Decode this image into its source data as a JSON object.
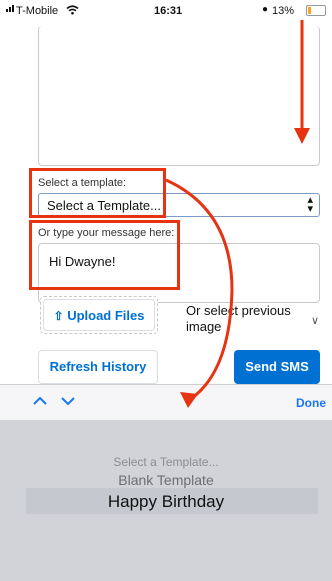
{
  "status_bar": {
    "carrier": "T-Mobile",
    "time": "16:31",
    "battery": "13%"
  },
  "form": {
    "template_label": "Select a template:",
    "template_select_value": "Select a Template...",
    "message_label": "Or type your message here:",
    "message_value": "Hi Dwayne!",
    "upload_label": "Upload Files",
    "previous_image_label": "Or select previous image",
    "refresh_label": "Refresh History",
    "send_label": "Send SMS"
  },
  "picker_toolbar": {
    "done_label": "Done"
  },
  "picker": {
    "options": [
      "Select a Template...",
      "Blank Template",
      "Happy Birthday"
    ],
    "selected_index": 2
  },
  "colors": {
    "accent": "#0070d2",
    "annotation": "#e63312"
  },
  "icons": [
    "wifi-icon",
    "upload-icon",
    "chevron-down-icon",
    "chevron-up-icon",
    "select-chevron-icon"
  ]
}
